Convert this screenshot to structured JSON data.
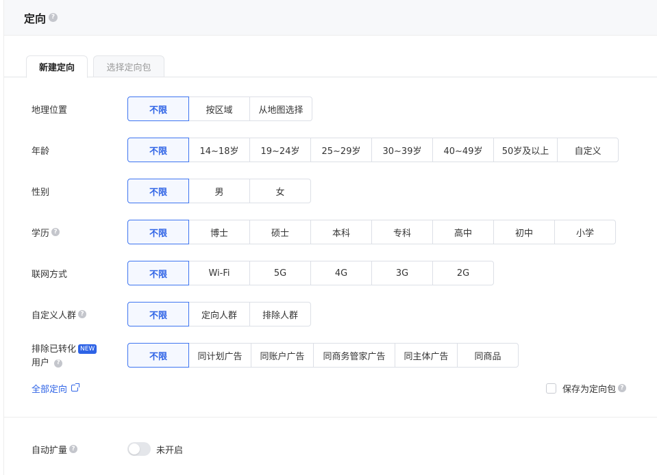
{
  "header": {
    "title": "定向"
  },
  "tabs": [
    {
      "label": "新建定向",
      "active": true
    },
    {
      "label": "选择定向包",
      "active": false
    }
  ],
  "rows": {
    "geo": {
      "label": "地理位置",
      "options": [
        "不限",
        "按区域",
        "从地图选择"
      ],
      "selected": "不限"
    },
    "age": {
      "label": "年龄",
      "options": [
        "不限",
        "14~18岁",
        "19~24岁",
        "25~29岁",
        "30~39岁",
        "40~49岁",
        "50岁及以上",
        "自定义"
      ],
      "selected": "不限"
    },
    "gender": {
      "label": "性别",
      "options": [
        "不限",
        "男",
        "女"
      ],
      "selected": "不限"
    },
    "education": {
      "label": "学历",
      "options": [
        "不限",
        "博士",
        "硕士",
        "本科",
        "专科",
        "高中",
        "初中",
        "小学"
      ],
      "selected": "不限"
    },
    "network": {
      "label": "联网方式",
      "options": [
        "不限",
        "Wi-Fi",
        "5G",
        "4G",
        "3G",
        "2G"
      ],
      "selected": "不限"
    },
    "custom_audience": {
      "label": "自定义人群",
      "options": [
        "不限",
        "定向人群",
        "排除人群"
      ],
      "selected": "不限"
    },
    "exclude_converted": {
      "label_line1": "排除已转化",
      "badge": "NEW",
      "label_line2": "用户",
      "options": [
        "不限",
        "同计划广告",
        "同账户广告",
        "同商务管家广告",
        "同主体广告",
        "同商品"
      ],
      "selected": "不限"
    }
  },
  "links": {
    "all_targeting": "全部定向",
    "save_as_pack": "保存为定向包"
  },
  "auto_expand": {
    "label": "自动扩量",
    "status": "未开启",
    "enabled": false
  },
  "colors": {
    "accent": "#2e63e6",
    "border": "#dcdfe6",
    "header_bg": "#f7f8fa"
  },
  "icons": {
    "help": "question-circle-icon",
    "external": "external-link-icon"
  }
}
